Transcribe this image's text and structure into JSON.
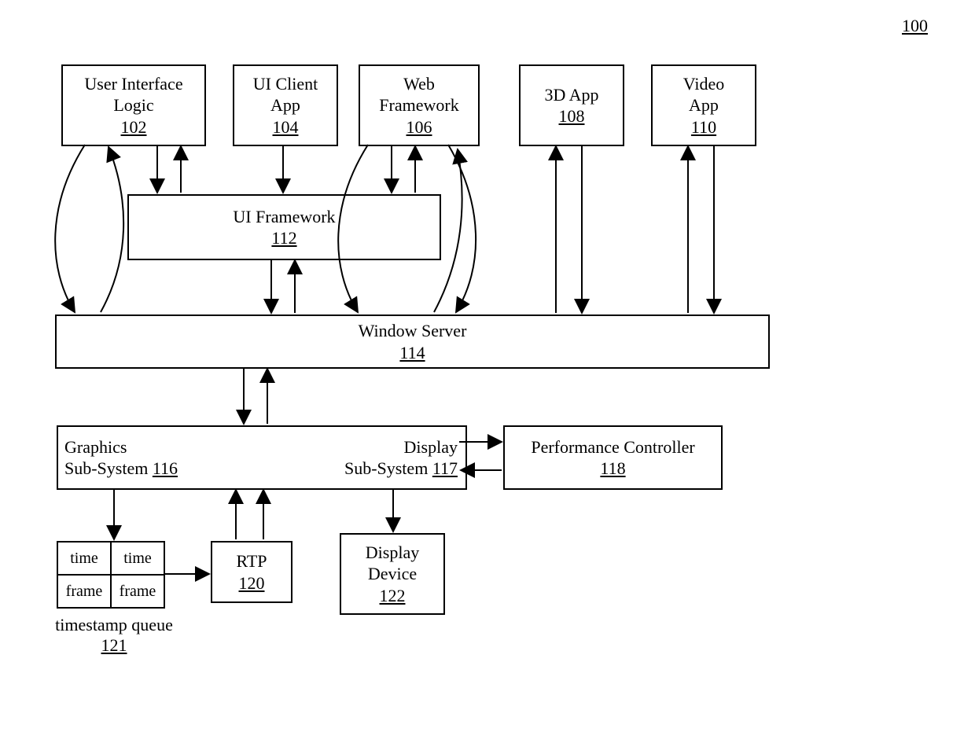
{
  "figure_ref": "100",
  "boxes": {
    "ui_logic": {
      "line1": "User Interface",
      "line2": "Logic",
      "ref": "102"
    },
    "ui_client": {
      "line1": "UI Client",
      "line2": "App",
      "ref": "104"
    },
    "web_fw": {
      "line1": "Web",
      "line2": "Framework",
      "ref": "106"
    },
    "app3d": {
      "line1": "3D App",
      "ref": "108"
    },
    "video": {
      "line1": "Video",
      "line2": "App",
      "ref": "110"
    },
    "ui_fw": {
      "line1": "UI Framework",
      "ref": "112"
    },
    "win_server": {
      "line1": "Window Server",
      "ref": "114"
    },
    "graphics": {
      "line1": "Graphics",
      "line2_prefix": "Sub-System ",
      "ref": "116"
    },
    "display": {
      "line1": "Display",
      "line2_prefix": "Sub-System ",
      "ref": "117"
    },
    "perf": {
      "line1": "Performance Controller",
      "ref": "118"
    },
    "rtp": {
      "line1": "RTP",
      "ref": "120"
    },
    "disp_dev": {
      "line1": "Display",
      "line2": "Device",
      "ref": "122"
    }
  },
  "ts_queue": {
    "cells": {
      "r0c0": "time",
      "r0c1": "time",
      "r1c0": "frame",
      "r1c1": "frame"
    },
    "label": "timestamp queue",
    "ref": "121"
  }
}
